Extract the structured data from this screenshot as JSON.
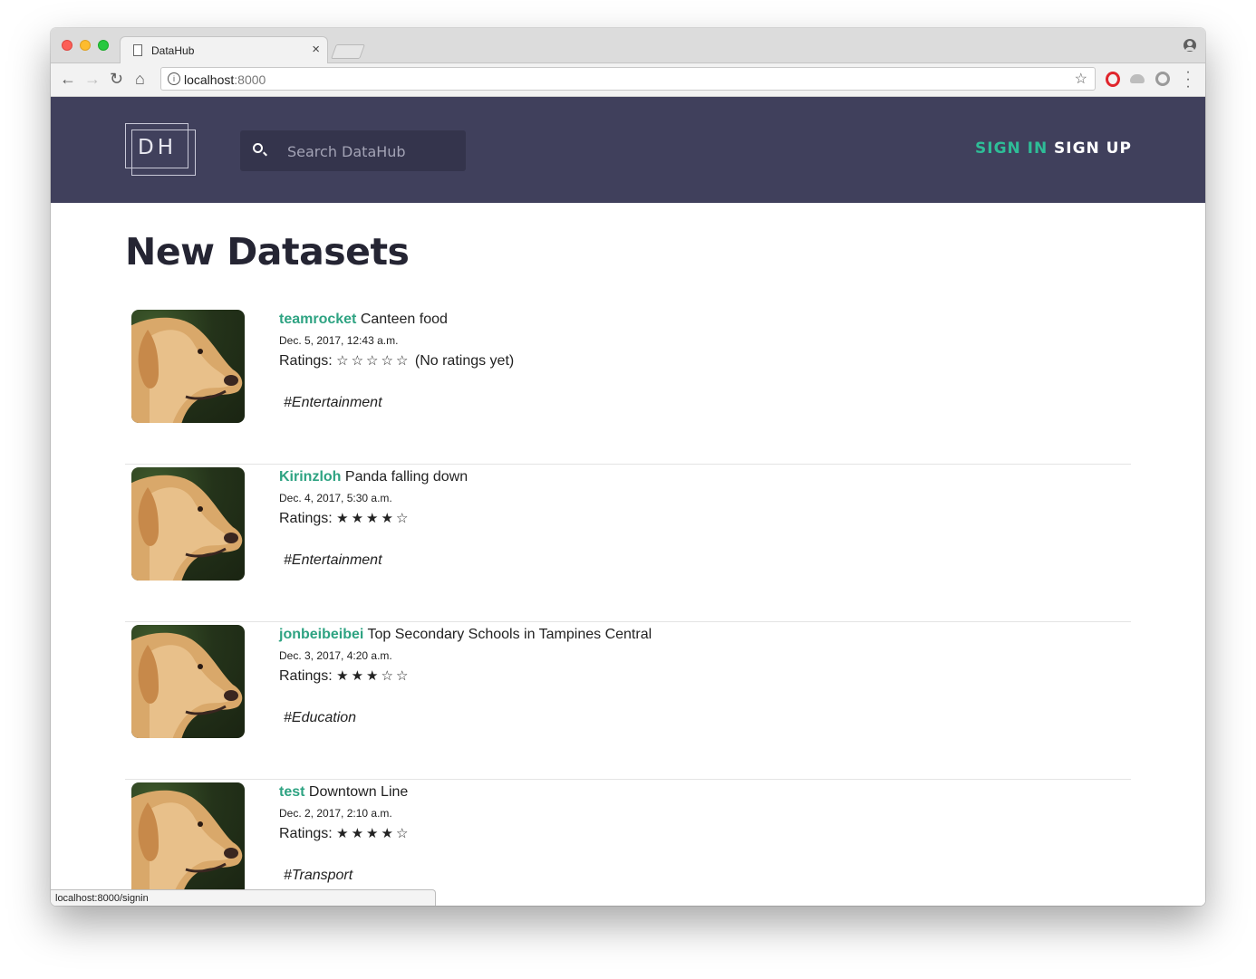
{
  "browser": {
    "tab_title": "DataHub",
    "tab_close": "×",
    "url_host": "localhost",
    "url_port": ":8000",
    "status_url": "localhost:8000/signin"
  },
  "header": {
    "logo_text": "DH",
    "search_placeholder": "Search DataHub",
    "signin_label": "SIGN IN",
    "signup_label": "SIGN UP",
    "colors": {
      "bg": "#40405c",
      "accent": "#2ebd97"
    }
  },
  "main": {
    "heading": "New Datasets",
    "datasets": [
      {
        "owner": "teamrocket",
        "title": "Canteen food",
        "date": "Dec. 5, 2017, 12:43 a.m.",
        "ratings_label": "Ratings:",
        "rating": 0,
        "stars": "☆☆☆☆☆",
        "rating_note": "(No ratings yet)",
        "tag": "#Entertainment"
      },
      {
        "owner": "Kirinzloh",
        "title": "Panda falling down",
        "date": "Dec. 4, 2017, 5:30 a.m.",
        "ratings_label": "Ratings:",
        "rating": 4,
        "stars": "★★★★☆",
        "rating_note": "",
        "tag": "#Entertainment"
      },
      {
        "owner": "jonbeibeibei",
        "title": "Top Secondary Schools in Tampines Central",
        "date": "Dec. 3, 2017, 4:20 a.m.",
        "ratings_label": "Ratings:",
        "rating": 3,
        "stars": "★★★☆☆",
        "rating_note": "",
        "tag": "#Education"
      },
      {
        "owner": "test",
        "title": "Downtown Line",
        "date": "Dec. 2, 2017, 2:10 a.m.",
        "ratings_label": "Ratings:",
        "rating": 4,
        "stars": "★★★★☆",
        "rating_note": "",
        "tag": "#Transport"
      }
    ]
  }
}
